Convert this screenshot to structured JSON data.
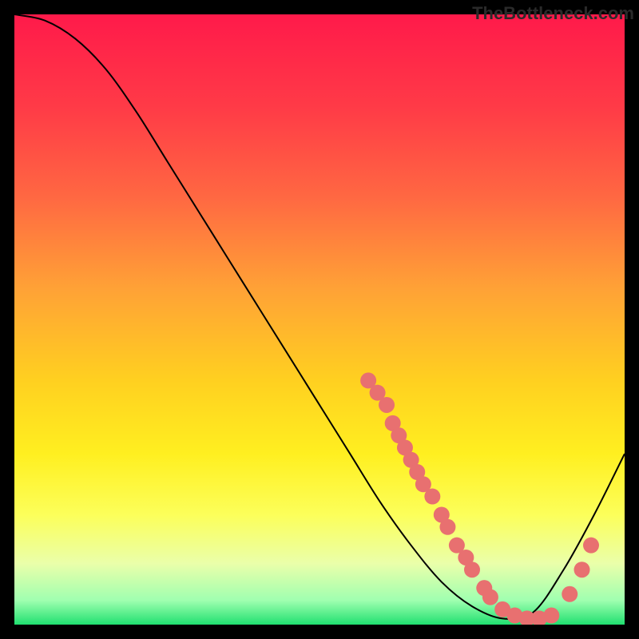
{
  "watermark": "TheBottleneck.com",
  "chart_data": {
    "type": "line",
    "title": "",
    "xlabel": "",
    "ylabel": "",
    "xlim": [
      0,
      100
    ],
    "ylim": [
      0,
      100
    ],
    "series": [
      {
        "name": "curve",
        "x": [
          0,
          5,
          10,
          15,
          20,
          25,
          30,
          35,
          40,
          45,
          50,
          55,
          60,
          65,
          70,
          75,
          80,
          85,
          90,
          95,
          100
        ],
        "values": [
          100,
          99,
          96,
          91,
          84,
          76,
          68,
          60,
          52,
          44,
          36,
          28,
          20,
          13,
          7,
          3,
          1,
          2,
          9,
          18,
          28
        ]
      }
    ],
    "scatter_points": [
      {
        "x": 58,
        "y": 40
      },
      {
        "x": 59.5,
        "y": 38
      },
      {
        "x": 61,
        "y": 36
      },
      {
        "x": 62,
        "y": 33
      },
      {
        "x": 63,
        "y": 31
      },
      {
        "x": 64,
        "y": 29
      },
      {
        "x": 65,
        "y": 27
      },
      {
        "x": 66,
        "y": 25
      },
      {
        "x": 67,
        "y": 23
      },
      {
        "x": 68.5,
        "y": 21
      },
      {
        "x": 70,
        "y": 18
      },
      {
        "x": 71,
        "y": 16
      },
      {
        "x": 72.5,
        "y": 13
      },
      {
        "x": 74,
        "y": 11
      },
      {
        "x": 75,
        "y": 9
      },
      {
        "x": 77,
        "y": 6
      },
      {
        "x": 78,
        "y": 4.5
      },
      {
        "x": 80,
        "y": 2.5
      },
      {
        "x": 82,
        "y": 1.5
      },
      {
        "x": 84,
        "y": 1
      },
      {
        "x": 86,
        "y": 1
      },
      {
        "x": 88,
        "y": 1.5
      },
      {
        "x": 91,
        "y": 5
      },
      {
        "x": 93,
        "y": 9
      },
      {
        "x": 94.5,
        "y": 13
      }
    ],
    "gradient_stops": [
      {
        "offset": 0,
        "color": "#ff1a4a"
      },
      {
        "offset": 15,
        "color": "#ff3a47"
      },
      {
        "offset": 30,
        "color": "#ff6842"
      },
      {
        "offset": 45,
        "color": "#ffa236"
      },
      {
        "offset": 60,
        "color": "#ffd020"
      },
      {
        "offset": 72,
        "color": "#ffef20"
      },
      {
        "offset": 82,
        "color": "#fcff5a"
      },
      {
        "offset": 90,
        "color": "#eaffaa"
      },
      {
        "offset": 96,
        "color": "#a0ffb0"
      },
      {
        "offset": 100,
        "color": "#20e070"
      }
    ],
    "marker_color": "#e87070",
    "marker_radius": 10,
    "line_color": "#000000"
  }
}
